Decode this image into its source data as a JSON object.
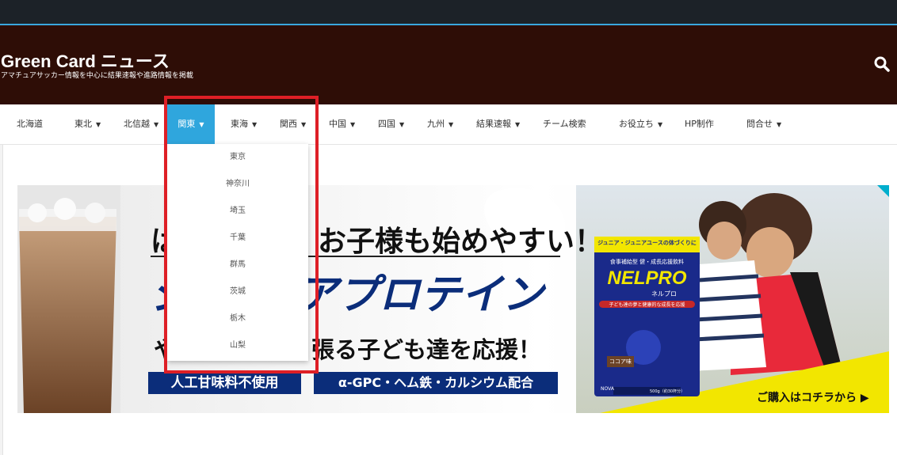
{
  "colors": {
    "topbar": "#1c2228",
    "topbar_accent": "#3aa7df",
    "header_bg": "#2e0d06",
    "nav_active": "#2fa6dd",
    "highlight_border": "#de1f26",
    "ad_navy": "#0b2d7a",
    "ad_yellow": "#f2e600"
  },
  "header": {
    "title": "Green Card ニュース",
    "subtitle": "アマチュアサッカー情報を中心に結果速報や進路情報を掲載",
    "search_icon": "search-icon"
  },
  "nav": {
    "items": [
      {
        "label": "北海道",
        "has_dropdown": false
      },
      {
        "label": "東北",
        "has_dropdown": true
      },
      {
        "label": "北信越",
        "has_dropdown": true
      },
      {
        "label": "関東",
        "has_dropdown": true,
        "active": true
      },
      {
        "label": "東海",
        "has_dropdown": true
      },
      {
        "label": "関西",
        "has_dropdown": true
      },
      {
        "label": "中国",
        "has_dropdown": true
      },
      {
        "label": "四国",
        "has_dropdown": true
      },
      {
        "label": "九州",
        "has_dropdown": true
      },
      {
        "label": "結果速報",
        "has_dropdown": true
      },
      {
        "label": "チーム検索",
        "has_dropdown": false
      },
      {
        "label": "お役立ち",
        "has_dropdown": true
      },
      {
        "label": "HP制作",
        "has_dropdown": false
      },
      {
        "label": "問合せ",
        "has_dropdown": true
      }
    ],
    "caret": "▼"
  },
  "dropdown": {
    "items": [
      "東京",
      "神奈川",
      "埼玉",
      "千葉",
      "群馬",
      "茨城",
      "栃木",
      "山梨"
    ]
  },
  "ad": {
    "headline_1": "は",
    "headline_1b": "お子様も始めやすい！",
    "headline_2": "ジ",
    "headline_2b": "アプロテイン",
    "headline_3": "や",
    "headline_3b": "張る子ども達を応援！",
    "badge_1": "人工甘味料不使用",
    "badge_2": "α-GPC・ヘム鉄・カルシウム配合",
    "package_top": "ジュニア・ジュニアユースの体づくりに",
    "package_sub": "食事補給型 健・成長応援飲料",
    "package_brand": "NELPRO",
    "package_brand_kana": "ネルプロ",
    "package_tag": "子ども達の夢と健康的な成長を応援",
    "package_flavor": "ココア味",
    "package_maker": "NOVA",
    "package_weight": "500g（約30杯分）",
    "cta": "ご購入はコチラから ▶",
    "adchoices_icon": "adchoices-icon"
  }
}
